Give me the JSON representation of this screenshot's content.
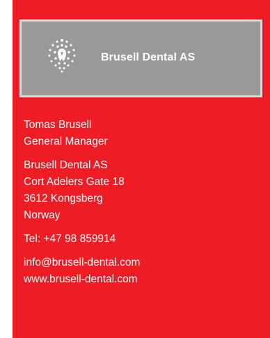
{
  "logo": {
    "company_name": "Brusell Dental AS",
    "icon": "dental-emblem-icon"
  },
  "contact": {
    "person": {
      "name": "Tomas Brusell",
      "title": "General Manager"
    },
    "address": {
      "company": "Brusell Dental AS",
      "street": "Cort Adelers Gate 18",
      "city": "3612 Kongsberg",
      "country": "Norway"
    },
    "phone": "Tel: +47 98 859914",
    "online": {
      "email": "info@brusell-dental.com",
      "website": "www.brusell-dental.com"
    }
  },
  "colors": {
    "card_background": "#ee1c25",
    "logo_background": "#999999",
    "logo_border": "#d9d9d9",
    "text": "#ffffff"
  }
}
